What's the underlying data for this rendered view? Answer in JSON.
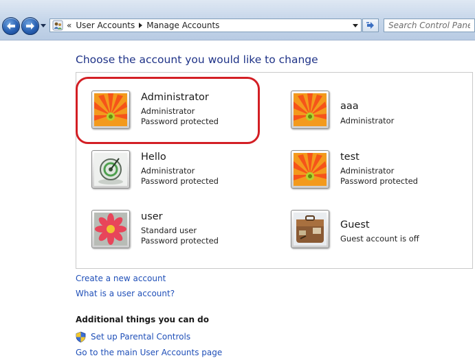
{
  "window": {
    "width": 691,
    "height": 522
  },
  "navbar": {
    "breadcrumb_chevron": "«",
    "breadcrumbs": [
      "User Accounts",
      "Manage Accounts"
    ],
    "search_placeholder": "Search Control Panel",
    "icons": {
      "back": "back-arrow-icon",
      "forward": "forward-arrow-icon",
      "recent": "chevron-down-icon",
      "location": "control-panel-users-icon",
      "refresh": "refresh-icon"
    }
  },
  "main": {
    "title": "Choose the account you would like to change",
    "accounts": [
      {
        "name": "Administrator",
        "lines": [
          "Administrator",
          "Password protected"
        ],
        "picture": "orange-flower"
      },
      {
        "name": "aaa",
        "lines": [
          "Administrator",
          ""
        ],
        "picture": "orange-flower"
      },
      {
        "name": "Hello",
        "lines": [
          "Administrator",
          "Password protected"
        ],
        "picture": "glass-sphere"
      },
      {
        "name": "test",
        "lines": [
          "Administrator",
          "Password protected"
        ],
        "picture": "orange-flower"
      },
      {
        "name": "user",
        "lines": [
          "Standard user",
          "Password protected"
        ],
        "picture": "pink-flower"
      },
      {
        "name": "Guest",
        "lines": [
          "Guest account is off",
          ""
        ],
        "picture": "suitcase"
      }
    ],
    "highlighted_account": "Administrator",
    "links": {
      "create_account": "Create a new account",
      "what_is": "What is a user account?"
    },
    "additional": {
      "heading": "Additional things you can do",
      "parental_controls": "Set up Parental Controls",
      "main_page": "Go to the main User Accounts page"
    }
  },
  "colors": {
    "title": "#1e3287",
    "link": "#1f4fb8",
    "highlight": "#d31e24",
    "navbar": "#c6d6ea"
  }
}
